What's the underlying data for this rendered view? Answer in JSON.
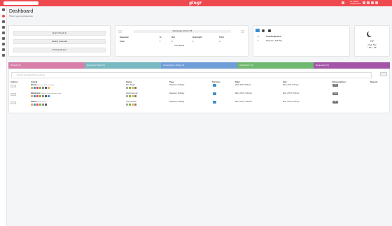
{
  "header": {
    "logo": "gingr",
    "user_name": "Ari Latinos",
    "user_role": "Google Drive"
  },
  "page": {
    "title": "Dashboard",
    "subtitle": "This is your central center"
  },
  "quick_actions": {
    "quick_checkin": "Quick Check In",
    "facility_calendar": "Facility Calendar",
    "printing_report": "Printing Report"
  },
  "calendar": {
    "date": "Wednesday 2021-07-28",
    "columns": [
      "Expected",
      "In",
      "Out",
      "Overnight",
      "Total"
    ],
    "rows": [
      {
        "label": "Total",
        "values": [
          "1",
          "0",
          "1",
          "4"
        ]
      }
    ],
    "view_detail": "View Detail"
  },
  "reservations_summary": {
    "columns": [
      "#",
      "Total Requested"
    ],
    "row": {
      "count": "1",
      "label": "Daycare | Full Day"
    }
  },
  "weather": {
    "temp": "72°",
    "desc": "Clear Sky",
    "range": "↑ 81° ↓ 63°"
  },
  "tabs": [
    {
      "label": "Arrivals (3)",
      "color": "#d77fa8"
    },
    {
      "label": "Expected Today (4)",
      "color": "#78b8c0"
    },
    {
      "label": "Going Home Today (4)",
      "color": "#6f9ed8"
    },
    {
      "label": "Checked In (4)",
      "color": "#6fb86f"
    },
    {
      "label": "Requested (3)",
      "color": "#a455a8"
    }
  ],
  "search_placeholder": "Search Requested Reservations",
  "table": {
    "headers": [
      "Actions",
      "Animal",
      "Owner",
      "Type",
      "Services",
      "Start",
      "End",
      "# Reservations",
      "Deposit"
    ],
    "rows": [
      {
        "animal": "Bennie",
        "breed": "(Bernese Mountain Dog)",
        "owner": "Ravi Singh",
        "type": "Daycare | Full Day",
        "start": "Wed, 07/6, 9:00 pm",
        "end": "Wed, 07/6, 2:00 pm",
        "count": "150"
      },
      {
        "animal": "Bluebmont",
        "breed": "(Greater Swiss Mountain Dog)",
        "owner": "Andrei Gomez",
        "type": "Daycare | Full Day",
        "start": "Mon, 07/27, 9:00 am",
        "end": "Mon, 07/27, 5:00 pm",
        "count": "153"
      },
      {
        "animal": "Peanut",
        "breed": "(Chihuahua)",
        "owner": "Jerry Gomez",
        "type": "Daycare | Full Day",
        "start": "Mon, 07/27, 9:00 am",
        "end": "Mon, 07/27, 5:00 pm",
        "count": "28"
      }
    ]
  }
}
